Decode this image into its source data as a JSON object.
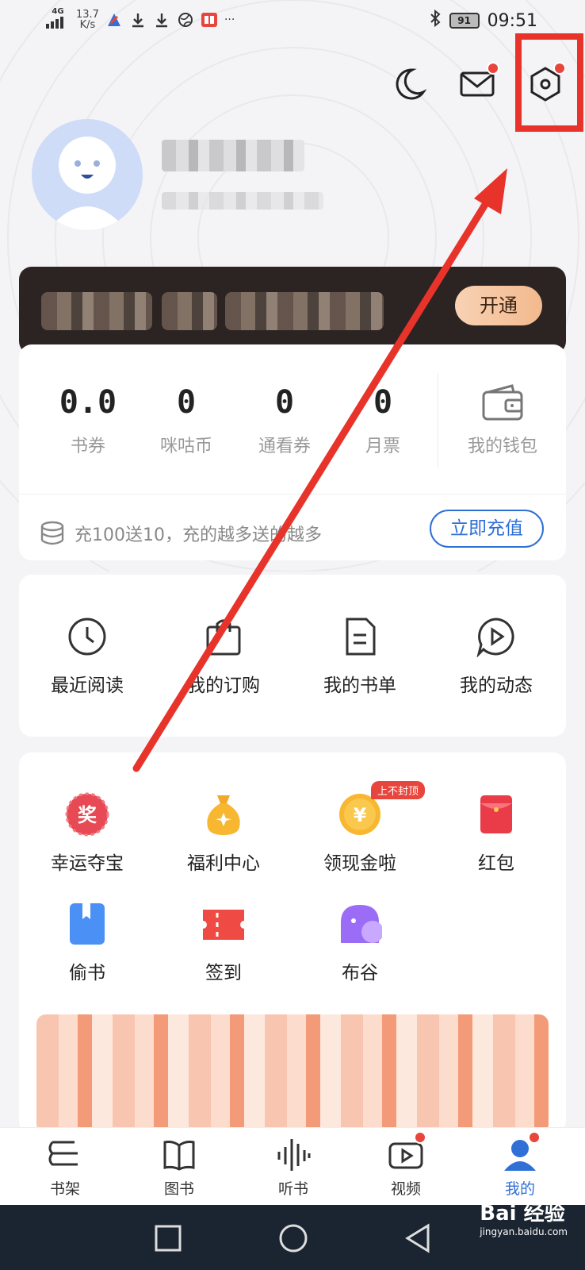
{
  "status_bar": {
    "network": "4G",
    "speed_value": "13.7",
    "speed_unit": "K/s",
    "more": "···",
    "battery": "91",
    "time": "09:51"
  },
  "vip": {
    "open_label": "开通"
  },
  "wallet": {
    "stats": [
      {
        "value": "0.0",
        "label": "书券"
      },
      {
        "value": "0",
        "label": "咪咕币"
      },
      {
        "value": "0",
        "label": "通看券"
      },
      {
        "value": "0",
        "label": "月票"
      }
    ],
    "wallet_label": "我的钱包",
    "promo_text": "充100送10，充的越多送的越多",
    "recharge_label": "立即充值"
  },
  "quick_links": [
    {
      "label": "最近阅读",
      "icon": "clock-icon"
    },
    {
      "label": "我的订购",
      "icon": "shopping-bag-icon"
    },
    {
      "label": "我的书单",
      "icon": "document-icon"
    },
    {
      "label": "我的动态",
      "icon": "play-bubble-icon"
    }
  ],
  "services": [
    {
      "label": "幸运夺宝",
      "icon": "prize-icon",
      "glyph": "奖"
    },
    {
      "label": "福利中心",
      "icon": "money-bag-icon"
    },
    {
      "label": "领现金啦",
      "icon": "yuan-coin-icon",
      "glyph": "¥",
      "tag": "上不封顶"
    },
    {
      "label": "红包",
      "icon": "red-envelope-icon"
    },
    {
      "label": "偷书",
      "icon": "book-icon"
    },
    {
      "label": "签到",
      "icon": "ticket-icon"
    },
    {
      "label": "布谷",
      "icon": "bird-icon"
    }
  ],
  "bottom_nav": [
    {
      "label": "书架",
      "icon": "bookshelf-icon"
    },
    {
      "label": "图书",
      "icon": "open-book-icon"
    },
    {
      "label": "听书",
      "icon": "audio-wave-icon"
    },
    {
      "label": "视频",
      "icon": "video-play-icon"
    },
    {
      "label": "我的",
      "icon": "user-icon",
      "active": true
    }
  ],
  "watermark": {
    "brand": "Bai 经验",
    "url": "jingyan.baidu.com"
  },
  "colors": {
    "accent_blue": "#2f6fd6",
    "badge_red": "#e8453c",
    "annotation_red": "#e8332a",
    "vip_dark": "#2b2422",
    "system_nav": "#1b2431"
  }
}
